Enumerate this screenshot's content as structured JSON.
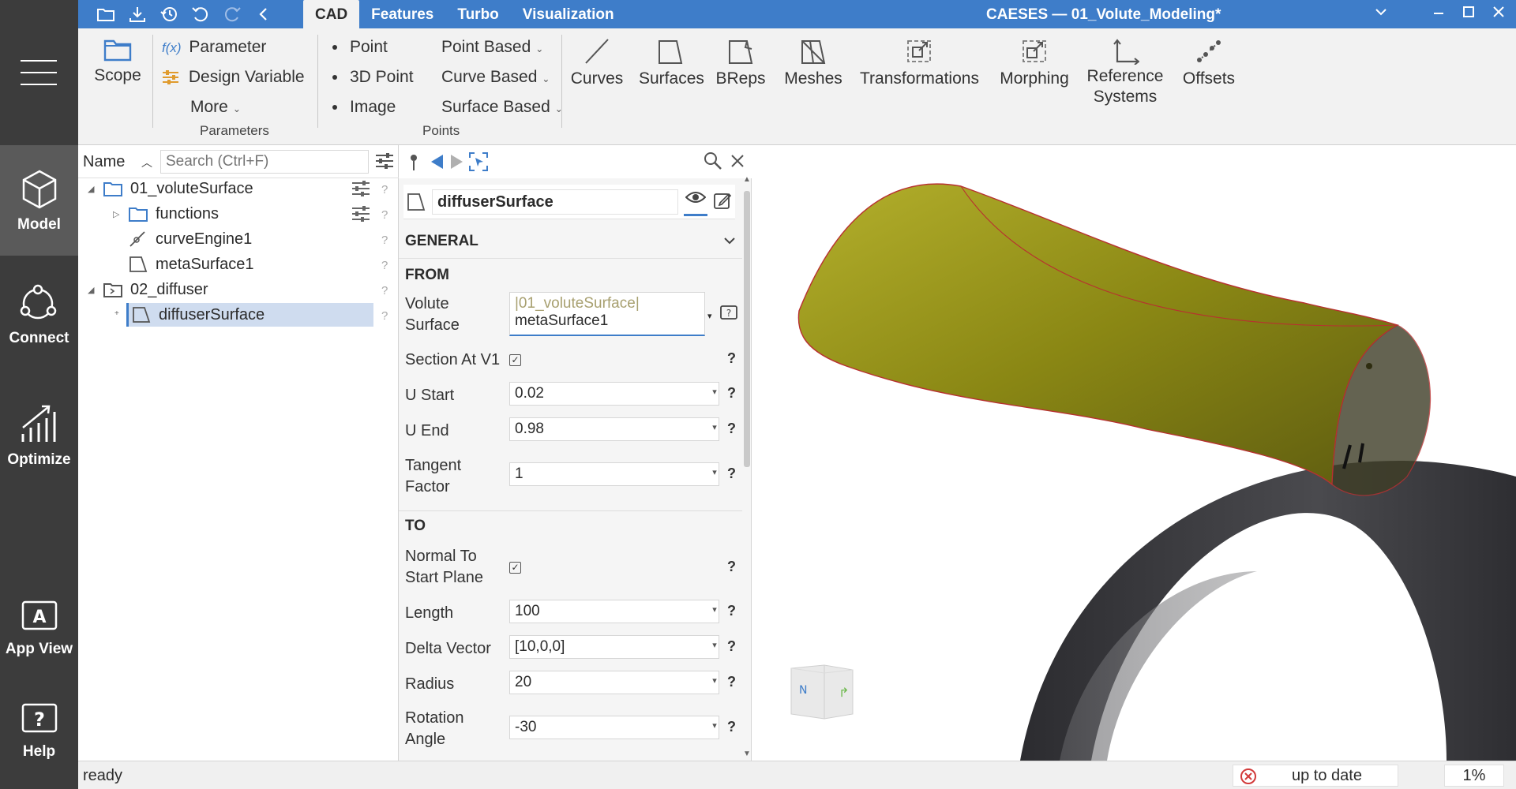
{
  "rail": {
    "items": [
      {
        "label": "Model"
      },
      {
        "label": "Connect"
      },
      {
        "label": "Optimize"
      },
      {
        "label": "App View"
      },
      {
        "label": "Help"
      }
    ]
  },
  "titlebar": {
    "tabs": [
      "CAD",
      "Features",
      "Turbo",
      "Visualization"
    ],
    "window_title": "CAESES — 01_Volute_Modeling*"
  },
  "ribbon": {
    "scope": "Scope",
    "parameter": "Parameter",
    "parameter_prefix": "f(x)",
    "design_variable": "Design Variable",
    "more": "More",
    "group_parameters": "Parameters",
    "point": "Point",
    "point_3d": "3D Point",
    "image": "Image",
    "point_based": "Point Based",
    "curve_based": "Curve Based",
    "surface_based": "Surface Based",
    "group_points": "Points",
    "curves": "Curves",
    "surfaces": "Surfaces",
    "breps": "BReps",
    "meshes": "Meshes",
    "transformations": "Transformations",
    "morphing": "Morphing",
    "reference_line1": "Reference",
    "reference_line2": "Systems",
    "offsets": "Offsets"
  },
  "tree": {
    "header_label": "Name",
    "search_placeholder": "Search (Ctrl+F)",
    "nodes": [
      {
        "label": "01_voluteSurface"
      },
      {
        "label": "functions"
      },
      {
        "label": "curveEngine1"
      },
      {
        "label": "metaSurface1"
      },
      {
        "label": "02_diffuser"
      },
      {
        "label": "diffuserSurface"
      }
    ]
  },
  "props": {
    "object_name": "diffuserSurface",
    "general": "GENERAL",
    "from": "FROM",
    "volute_surface_l1": "Volute",
    "volute_surface_l2": "Surface",
    "volute_surface_hint": "|01_voluteSurface|",
    "volute_surface_value": "metaSurface1",
    "section_at_v1": "Section At V1",
    "u_start": "U Start",
    "u_start_value": "0.02",
    "u_end": "U End",
    "u_end_value": "0.98",
    "tangent_l1": "Tangent",
    "tangent_l2": "Factor",
    "tangent_value": "1",
    "to": "TO",
    "normal_l1": "Normal To",
    "normal_l2": "Start Plane",
    "length": "Length",
    "length_value": "100",
    "delta_vector": "Delta Vector",
    "delta_vector_value": "[10,0,0]",
    "radius": "Radius",
    "radius_value": "20",
    "rotation_l1": "Rotation",
    "rotation_l2": "Angle",
    "rotation_value": "-30",
    "q": "?"
  },
  "viewcube": {
    "north": "N"
  },
  "status": {
    "text": "ready",
    "update_state": "up to date",
    "percent": "1%"
  },
  "colors": {
    "accent": "#3e7dc9",
    "rail": "#3c3c3c",
    "surface_yellow": "#8b8a10",
    "volute_grey": "#3a3a3c"
  }
}
